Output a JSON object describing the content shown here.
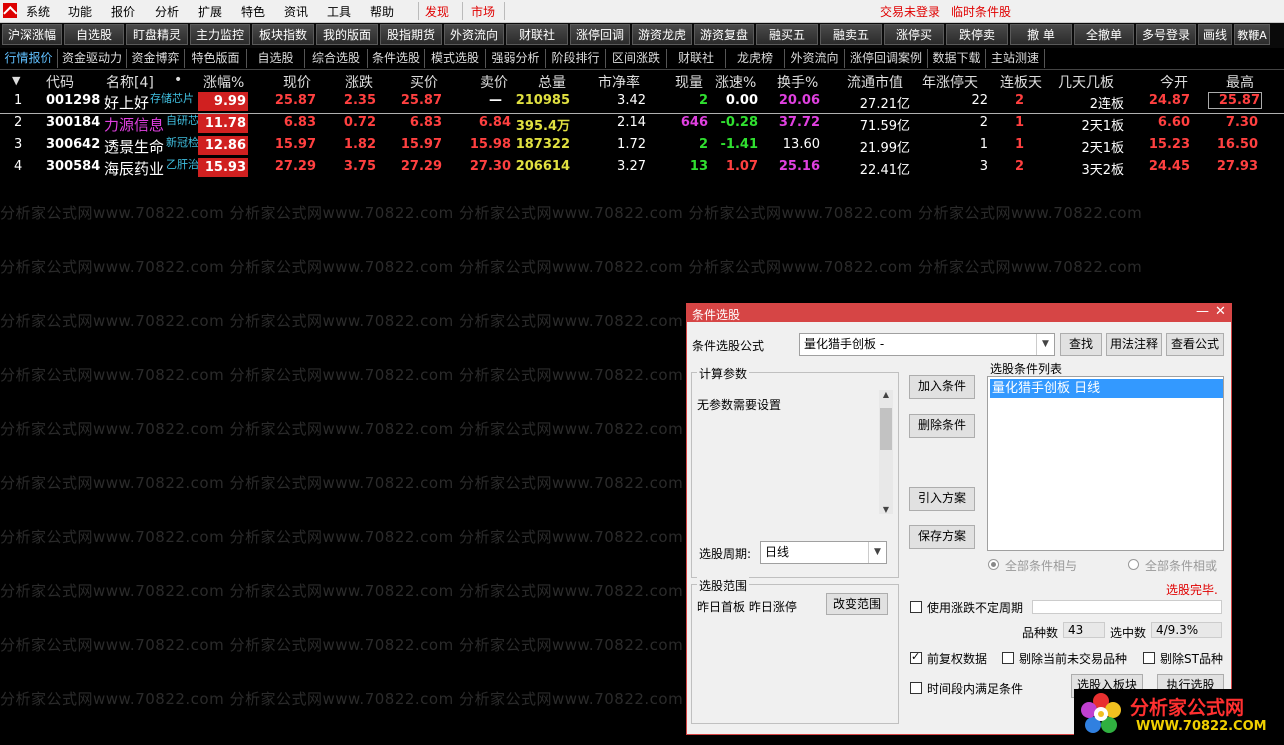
{
  "menu": {
    "items": [
      "系统",
      "功能",
      "报价",
      "分析",
      "扩展",
      "特色",
      "资讯",
      "工具",
      "帮助"
    ],
    "find": "发现",
    "market": "市场",
    "status": "交易未登录",
    "alert": "临时条件股"
  },
  "toolbar": [
    "沪深涨幅",
    "自选股",
    "盯盘精灵",
    "主力监控",
    "板块指数",
    "我的版面",
    "股指期货",
    "外资流向",
    "财联社",
    "涨停回调",
    "游资龙虎",
    "游资复盘",
    "融买五",
    "融卖五",
    "涨停买",
    "跌停卖",
    "撤 单",
    "全撤单",
    "多号登录",
    "画线",
    "教鞭A"
  ],
  "tabs": [
    "行情报价",
    "资金驱动力",
    "资金博弈",
    "特色版面",
    "自选股",
    "综合选股",
    "条件选股",
    "模式选股",
    "强弱分析",
    "阶段排行",
    "区间涨跌",
    "财联社",
    "龙虎榜",
    "外资流向",
    "涨停回调案例",
    "数据下载",
    "主站测速"
  ],
  "columns": {
    "arrow": "▼",
    "code": "代码",
    "name": "名称[4]",
    "dot": "•",
    "chg": "涨幅%",
    "price": "现价",
    "diff": "涨跌",
    "bid": "买价",
    "ask": "卖价",
    "vol": "总量",
    "pb": "市净率",
    "cur": "现量",
    "speed": "涨速%",
    "turnover": "换手%",
    "cap": "流通市值",
    "ylimit": "年涨停天",
    "streak": "连板天",
    "days": "几天几板",
    "open": "今开",
    "high": "最高"
  },
  "rows": [
    {
      "idx": "1",
      "code": "001298",
      "name": "好上好",
      "tag": "存储芯片",
      "chg": "9.99",
      "price": "25.87",
      "diff": "2.35",
      "bid": "25.87",
      "ask": "—",
      "vol": "210985",
      "pb": "3.42",
      "cur": "2",
      "speed": "0.00",
      "turnover": "20.06",
      "cap": "27.21亿",
      "ylimit": "22",
      "streak": "2",
      "days": "2连板",
      "open": "24.87",
      "high": "25.87"
    },
    {
      "idx": "2",
      "code": "300184",
      "name": "力源信息",
      "tag": "自研芯",
      "chg": "11.78",
      "price": "6.83",
      "diff": "0.72",
      "bid": "6.83",
      "ask": "6.84",
      "vol": "395.4万",
      "pb": "2.14",
      "cur": "646",
      "speed": "-0.28",
      "turnover": "37.72",
      "cap": "71.59亿",
      "ylimit": "2",
      "streak": "1",
      "days": "2天1板",
      "open": "6.60",
      "high": "7.30"
    },
    {
      "idx": "3",
      "code": "300642",
      "name": "透景生命",
      "tag": "新冠检",
      "chg": "12.86",
      "price": "15.97",
      "diff": "1.82",
      "bid": "15.97",
      "ask": "15.98",
      "vol": "187322",
      "pb": "1.72",
      "cur": "2",
      "speed": "-1.41",
      "turnover": "13.60",
      "cap": "21.99亿",
      "ylimit": "1",
      "streak": "1",
      "days": "2天1板",
      "open": "15.23",
      "high": "16.50"
    },
    {
      "idx": "4",
      "code": "300584",
      "name": "海辰药业",
      "tag": "乙肝治",
      "chg": "15.93",
      "price": "27.29",
      "diff": "3.75",
      "bid": "27.29",
      "ask": "27.30",
      "vol": "206614",
      "pb": "3.27",
      "cur": "13",
      "speed": "1.07",
      "turnover": "25.16",
      "cap": "22.41亿",
      "ylimit": "3",
      "streak": "2",
      "days": "3天2板",
      "open": "24.45",
      "high": "27.93"
    }
  ],
  "watermark": "分析家公式网www.70822.com",
  "dialog": {
    "title": "条件选股",
    "formula_label": "条件选股公式",
    "formula_value": "量化猎手创板  -",
    "find": "查找",
    "usage": "用法注释",
    "view": "查看公式",
    "params_label": "计算参数",
    "params_text": "无参数需要设置",
    "add": "加入条件",
    "delete": "删除条件",
    "import": "引入方案",
    "save": "保存方案",
    "cond_list_label": "选股条件列表",
    "cond_item": "量化猎手创板  日线",
    "period_label": "选股周期:",
    "period_value": "日线",
    "all_and": "全部条件相与",
    "all_or": "全部条件相或",
    "done": "选股完毕.",
    "range_label": "选股范围",
    "range_text": "昨日首板 昨日涨停",
    "change_range": "改变范围",
    "use_period": "使用涨跌不定周期",
    "count_label": "品种数",
    "count_value": "43",
    "selected_label": "选中数",
    "selected_value": "4/9.3%",
    "fq": "前复权数据",
    "exclude_untraded": "剔除当前未交易品种",
    "exclude_st": "剔除ST品种",
    "time_cond": "时间段内满足条件",
    "to_block": "选股入板块",
    "execute": "执行选股"
  },
  "logo": {
    "text": "分析家公式网",
    "url": "WWW.70822.COM"
  }
}
